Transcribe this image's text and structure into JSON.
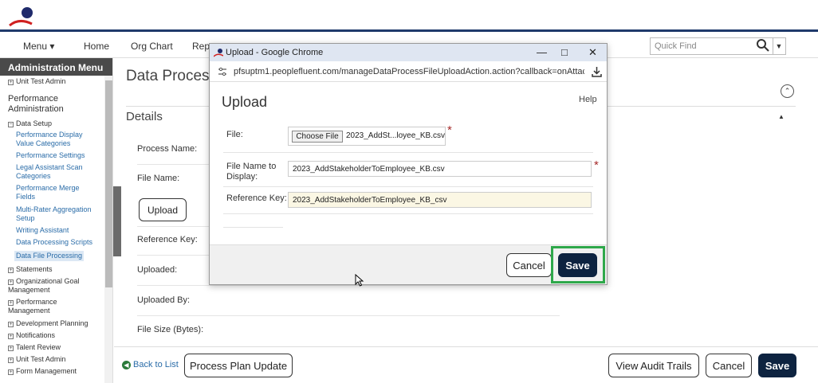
{
  "nav": {
    "menu_label": "Menu ▾",
    "items": [
      "Home",
      "Org Chart",
      "Repo"
    ],
    "quickfind_placeholder": "Quick Find"
  },
  "sidebar": {
    "header": "Administration Menu",
    "top_item": "Unit Test Admin",
    "section_title": "Performance Administration",
    "data_setup": "Data Setup",
    "sub_items": [
      "Performance Display Value Categories",
      "Performance Settings",
      "Legal Assistant Scan Categories",
      "Performance Merge Fields",
      "Multi-Rater Aggregation Setup",
      "Writing Assistant",
      "Data Processing Scripts",
      "Data File Processing"
    ],
    "groups": [
      "Statements",
      "Organizational Goal Management",
      "Performance Management",
      "Development Planning",
      "Notifications",
      "Talent Review",
      "Unit Test Admin",
      "Form Management"
    ]
  },
  "main": {
    "title": "Data Process",
    "details_heading": "Details",
    "labels": {
      "process_name": "Process Name:",
      "file_name": "File Name:",
      "reference_key": "Reference Key:",
      "uploaded": "Uploaded:",
      "uploaded_by": "Uploaded By:",
      "file_size": "File Size (Bytes):"
    },
    "upload_button": "Upload"
  },
  "footer": {
    "back_link": "Back to List",
    "process_plan_update": "Process Plan Update",
    "view_audit_trails": "View Audit Trails",
    "cancel": "Cancel",
    "save": "Save"
  },
  "popup": {
    "window_title": "Upload - Google Chrome",
    "url": "pfsuptm1.peoplefluent.com/manageDataProcessFileUploadAction.action?callback=onAttac...",
    "heading": "Upload",
    "help": "Help",
    "file_label": "File:",
    "choose_file": "Choose File",
    "chosen_file": "2023_AddSt...loyee_KB.csv",
    "display_label": "File Name to Display:",
    "display_value": "2023_AddStakeholderToEmployee_KB.csv",
    "refkey_label": "Reference Key:",
    "refkey_value": "2023_AddStakeholderToEmployee_KB_csv",
    "cancel": "Cancel",
    "save": "Save",
    "required_mark": "*"
  },
  "colors": {
    "brand_navy": "#0d2340",
    "header_rule": "#1f3a6b",
    "highlight_green": "#2ea84a",
    "link_blue": "#2a6ca8"
  }
}
